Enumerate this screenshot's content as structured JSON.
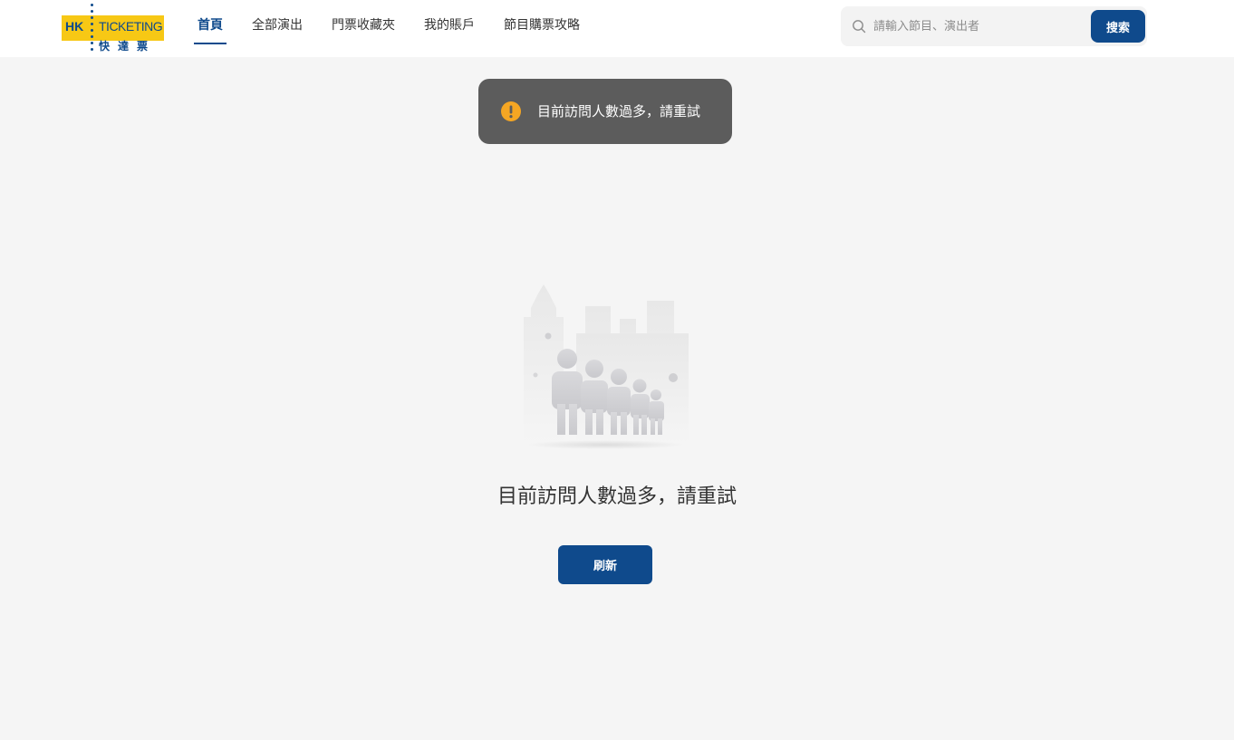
{
  "header": {
    "logo": {
      "brand_en_prefix": "HK",
      "brand_en": "TICKETING",
      "brand_zh": "快達票"
    },
    "nav": [
      {
        "label": "首頁",
        "active": true
      },
      {
        "label": "全部演出",
        "active": false
      },
      {
        "label": "門票收藏夾",
        "active": false
      },
      {
        "label": "我的賬戶",
        "active": false
      },
      {
        "label": "節目購票攻略",
        "active": false
      }
    ],
    "search": {
      "placeholder": "請輸入節目、演出者",
      "value": "",
      "button_label": "搜索",
      "icon": "search-icon"
    }
  },
  "toast": {
    "icon": "warning-icon",
    "icon_color": "#f5a623",
    "message": "目前訪問人數過多，請重試"
  },
  "main": {
    "illustration": "crowd-waiting-illustration",
    "message": "目前訪問人數過多，請重試",
    "refresh_label": "刷新"
  },
  "colors": {
    "brand_blue": "#0f4a8c",
    "brand_yellow": "#f7c815",
    "page_background": "#f5f5f5",
    "toast_background": "#5c5c5c"
  }
}
